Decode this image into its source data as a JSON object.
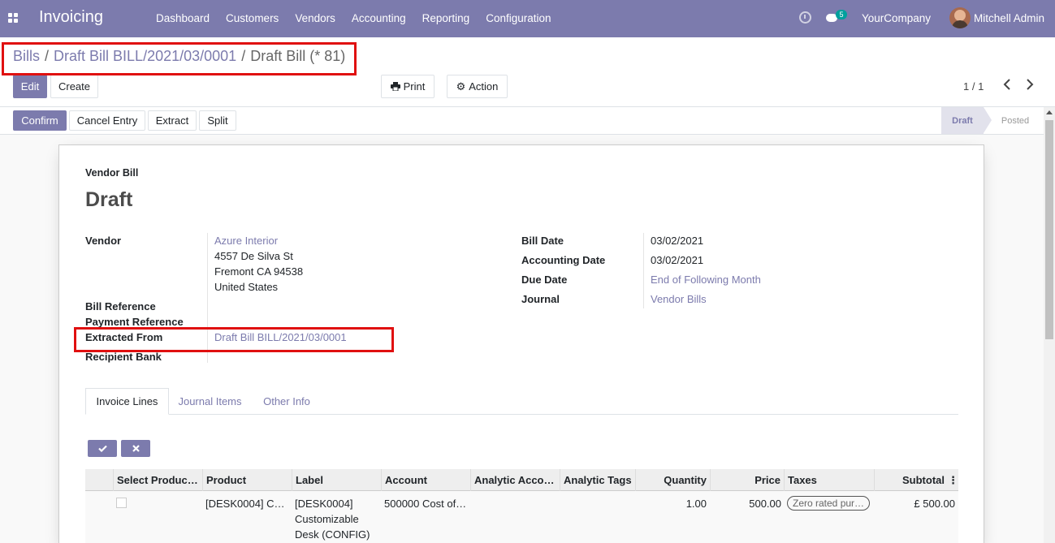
{
  "navbar": {
    "app_name": "Invoicing",
    "menu": [
      "Dashboard",
      "Customers",
      "Vendors",
      "Accounting",
      "Reporting",
      "Configuration"
    ],
    "chat_badge": "5",
    "company": "YourCompany",
    "user": "Mitchell Admin"
  },
  "breadcrumb": {
    "item1": "Bills",
    "item2": "Draft Bill BILL/2021/03/0001",
    "current": "Draft Bill (* 81)",
    "separator": "/"
  },
  "toolbar": {
    "edit": "Edit",
    "create": "Create",
    "print": "Print",
    "action": "Action",
    "pager": "1 / 1"
  },
  "status_actions": {
    "confirm": "Confirm",
    "cancel_entry": "Cancel Entry",
    "extract": "Extract",
    "split": "Split"
  },
  "stages": {
    "active": "Draft",
    "next": "Posted"
  },
  "form": {
    "type_label": "Vendor Bill",
    "title": "Draft",
    "vendor_label": "Vendor",
    "vendor_name": "Azure Interior",
    "vendor_addr1": "4557 De Silva St",
    "vendor_addr2": "Fremont CA 94538",
    "vendor_addr3": "United States",
    "bill_reference_label": "Bill Reference",
    "payment_reference_label": "Payment Reference",
    "extracted_from_label": "Extracted From",
    "extracted_from_value": "Draft Bill BILL/2021/03/0001",
    "recipient_bank_label": "Recipient Bank",
    "bill_date_label": "Bill Date",
    "bill_date": "03/02/2021",
    "accounting_date_label": "Accounting Date",
    "accounting_date": "03/02/2021",
    "due_date_label": "Due Date",
    "due_date": "End of Following Month",
    "journal_label": "Journal",
    "journal": "Vendor Bills"
  },
  "tabs": [
    "Invoice Lines",
    "Journal Items",
    "Other Info"
  ],
  "table": {
    "headers": [
      "Select Produc…",
      "Product",
      "Label",
      "Account",
      "Analytic Acco…",
      "Analytic Tags",
      "Quantity",
      "Price",
      "Taxes",
      "Subtotal"
    ],
    "row": {
      "product": "[DESK0004] C…",
      "label_line1": "[DESK0004]",
      "label_line2": "Customizable",
      "label_line3": "Desk (CONFIG)",
      "account": "500000 Cost of…",
      "quantity": "1.00",
      "price": "500.00",
      "tax": "Zero rated pur…",
      "subtotal": "£ 500.00"
    }
  },
  "colors": {
    "brand": "#7c7bad",
    "highlight": "#e01010",
    "odoo_teal": "#00a09d"
  }
}
